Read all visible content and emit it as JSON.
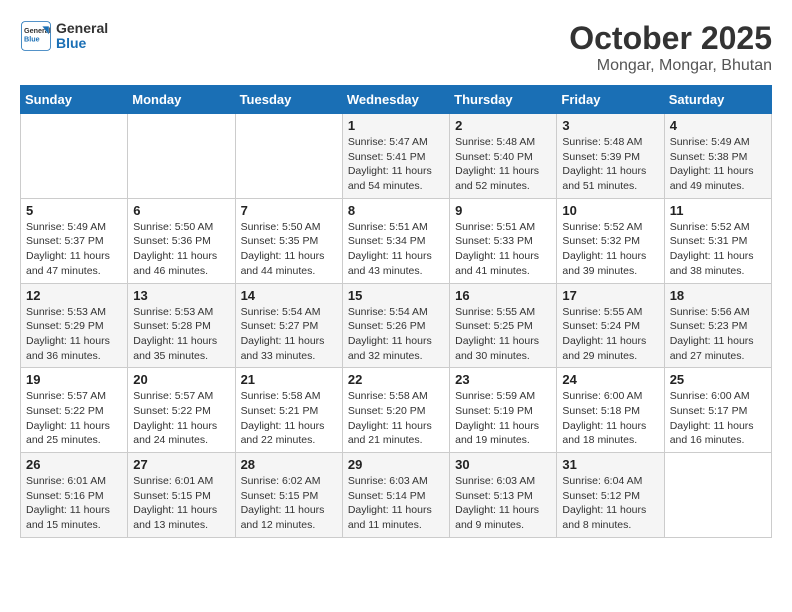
{
  "logo": {
    "line1": "General",
    "line2": "Blue"
  },
  "title": "October 2025",
  "subtitle": "Mongar, Mongar, Bhutan",
  "days_of_week": [
    "Sunday",
    "Monday",
    "Tuesday",
    "Wednesday",
    "Thursday",
    "Friday",
    "Saturday"
  ],
  "weeks": [
    [
      {
        "day": "",
        "info": ""
      },
      {
        "day": "",
        "info": ""
      },
      {
        "day": "",
        "info": ""
      },
      {
        "day": "1",
        "info": "Sunrise: 5:47 AM\nSunset: 5:41 PM\nDaylight: 11 hours\nand 54 minutes."
      },
      {
        "day": "2",
        "info": "Sunrise: 5:48 AM\nSunset: 5:40 PM\nDaylight: 11 hours\nand 52 minutes."
      },
      {
        "day": "3",
        "info": "Sunrise: 5:48 AM\nSunset: 5:39 PM\nDaylight: 11 hours\nand 51 minutes."
      },
      {
        "day": "4",
        "info": "Sunrise: 5:49 AM\nSunset: 5:38 PM\nDaylight: 11 hours\nand 49 minutes."
      }
    ],
    [
      {
        "day": "5",
        "info": "Sunrise: 5:49 AM\nSunset: 5:37 PM\nDaylight: 11 hours\nand 47 minutes."
      },
      {
        "day": "6",
        "info": "Sunrise: 5:50 AM\nSunset: 5:36 PM\nDaylight: 11 hours\nand 46 minutes."
      },
      {
        "day": "7",
        "info": "Sunrise: 5:50 AM\nSunset: 5:35 PM\nDaylight: 11 hours\nand 44 minutes."
      },
      {
        "day": "8",
        "info": "Sunrise: 5:51 AM\nSunset: 5:34 PM\nDaylight: 11 hours\nand 43 minutes."
      },
      {
        "day": "9",
        "info": "Sunrise: 5:51 AM\nSunset: 5:33 PM\nDaylight: 11 hours\nand 41 minutes."
      },
      {
        "day": "10",
        "info": "Sunrise: 5:52 AM\nSunset: 5:32 PM\nDaylight: 11 hours\nand 39 minutes."
      },
      {
        "day": "11",
        "info": "Sunrise: 5:52 AM\nSunset: 5:31 PM\nDaylight: 11 hours\nand 38 minutes."
      }
    ],
    [
      {
        "day": "12",
        "info": "Sunrise: 5:53 AM\nSunset: 5:29 PM\nDaylight: 11 hours\nand 36 minutes."
      },
      {
        "day": "13",
        "info": "Sunrise: 5:53 AM\nSunset: 5:28 PM\nDaylight: 11 hours\nand 35 minutes."
      },
      {
        "day": "14",
        "info": "Sunrise: 5:54 AM\nSunset: 5:27 PM\nDaylight: 11 hours\nand 33 minutes."
      },
      {
        "day": "15",
        "info": "Sunrise: 5:54 AM\nSunset: 5:26 PM\nDaylight: 11 hours\nand 32 minutes."
      },
      {
        "day": "16",
        "info": "Sunrise: 5:55 AM\nSunset: 5:25 PM\nDaylight: 11 hours\nand 30 minutes."
      },
      {
        "day": "17",
        "info": "Sunrise: 5:55 AM\nSunset: 5:24 PM\nDaylight: 11 hours\nand 29 minutes."
      },
      {
        "day": "18",
        "info": "Sunrise: 5:56 AM\nSunset: 5:23 PM\nDaylight: 11 hours\nand 27 minutes."
      }
    ],
    [
      {
        "day": "19",
        "info": "Sunrise: 5:57 AM\nSunset: 5:22 PM\nDaylight: 11 hours\nand 25 minutes."
      },
      {
        "day": "20",
        "info": "Sunrise: 5:57 AM\nSunset: 5:22 PM\nDaylight: 11 hours\nand 24 minutes."
      },
      {
        "day": "21",
        "info": "Sunrise: 5:58 AM\nSunset: 5:21 PM\nDaylight: 11 hours\nand 22 minutes."
      },
      {
        "day": "22",
        "info": "Sunrise: 5:58 AM\nSunset: 5:20 PM\nDaylight: 11 hours\nand 21 minutes."
      },
      {
        "day": "23",
        "info": "Sunrise: 5:59 AM\nSunset: 5:19 PM\nDaylight: 11 hours\nand 19 minutes."
      },
      {
        "day": "24",
        "info": "Sunrise: 6:00 AM\nSunset: 5:18 PM\nDaylight: 11 hours\nand 18 minutes."
      },
      {
        "day": "25",
        "info": "Sunrise: 6:00 AM\nSunset: 5:17 PM\nDaylight: 11 hours\nand 16 minutes."
      }
    ],
    [
      {
        "day": "26",
        "info": "Sunrise: 6:01 AM\nSunset: 5:16 PM\nDaylight: 11 hours\nand 15 minutes."
      },
      {
        "day": "27",
        "info": "Sunrise: 6:01 AM\nSunset: 5:15 PM\nDaylight: 11 hours\nand 13 minutes."
      },
      {
        "day": "28",
        "info": "Sunrise: 6:02 AM\nSunset: 5:15 PM\nDaylight: 11 hours\nand 12 minutes."
      },
      {
        "day": "29",
        "info": "Sunrise: 6:03 AM\nSunset: 5:14 PM\nDaylight: 11 hours\nand 11 minutes."
      },
      {
        "day": "30",
        "info": "Sunrise: 6:03 AM\nSunset: 5:13 PM\nDaylight: 11 hours\nand 9 minutes."
      },
      {
        "day": "31",
        "info": "Sunrise: 6:04 AM\nSunset: 5:12 PM\nDaylight: 11 hours\nand 8 minutes."
      },
      {
        "day": "",
        "info": ""
      }
    ]
  ]
}
